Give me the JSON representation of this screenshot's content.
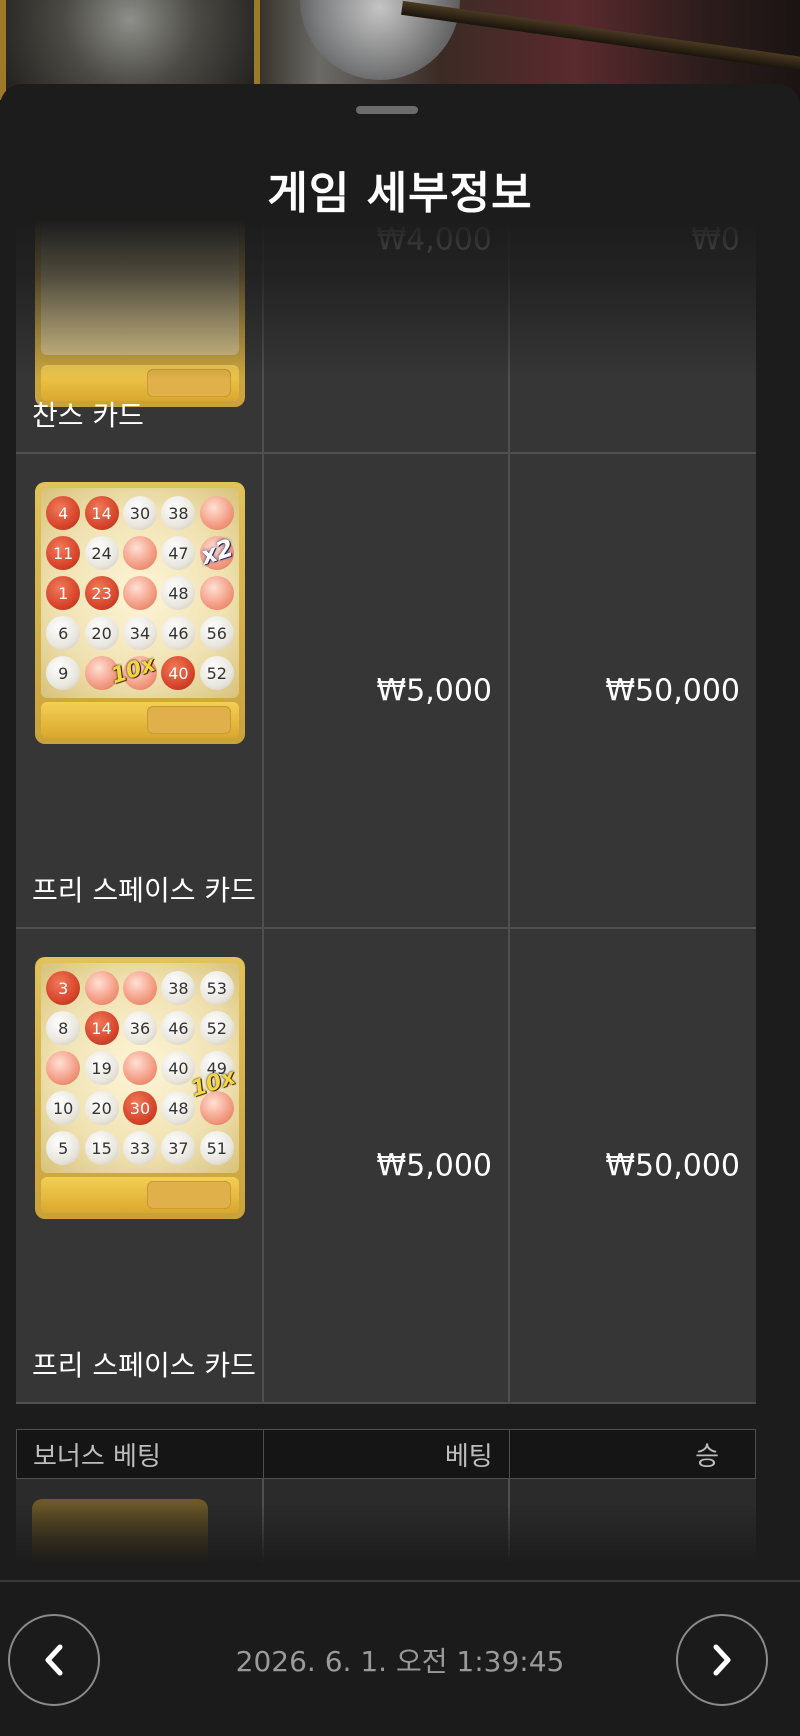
{
  "header": {
    "title": "게임 세부정보"
  },
  "rows": [
    {
      "label": "찬스 카드",
      "bet": "₩4,000",
      "win": "₩0"
    },
    {
      "label": "프리 스페이스 카드",
      "bet": "₩5,000",
      "win": "₩50,000",
      "card": {
        "numbers": [
          "4",
          "14",
          "30",
          "38",
          "",
          "11",
          "24",
          "",
          "47",
          "",
          "1",
          "23",
          "",
          "48",
          "",
          "6",
          "20",
          "34",
          "46",
          "56",
          "9",
          "",
          "",
          "40",
          "52"
        ],
        "badges": [
          "10x",
          "x2"
        ]
      }
    },
    {
      "label": "프리 스페이스 카드",
      "bet": "₩5,000",
      "win": "₩50,000",
      "card": {
        "numbers": [
          "3",
          "",
          "",
          "38",
          "53",
          "8",
          "14",
          "36",
          "46",
          "52",
          "",
          "19",
          "",
          "40",
          "49",
          "10",
          "20",
          "30",
          "48",
          "",
          "5",
          "15",
          "33",
          "37",
          "51"
        ],
        "badges": [
          "10x"
        ]
      }
    }
  ],
  "bonus_table": {
    "col1": "보너스 베팅",
    "col2": "베팅",
    "col3": "승"
  },
  "footer": {
    "timestamp": "2026. 6. 1. 오전 1:39:45"
  },
  "icons": {
    "back": "arrow-left-icon",
    "close": "close-icon",
    "prev": "chevron-left-icon",
    "next": "chevron-right-icon"
  }
}
